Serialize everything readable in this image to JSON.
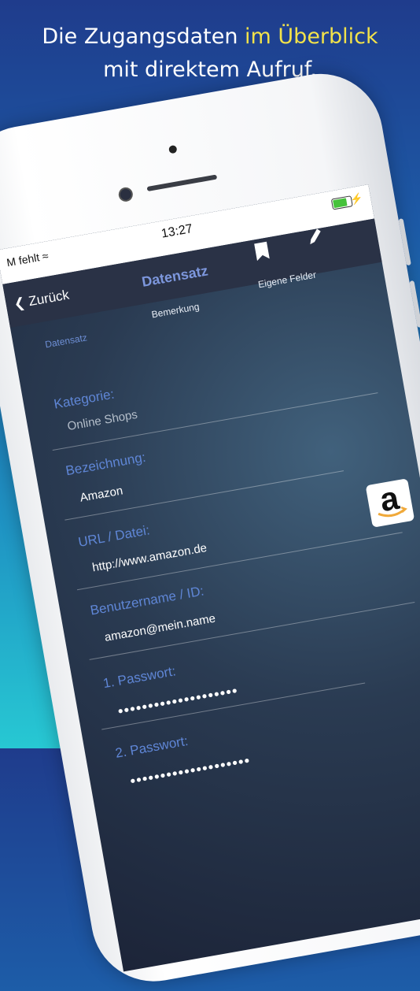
{
  "headline": {
    "line1_prefix": "Die Zugangsdaten ",
    "line1_highlight": "im Überblick",
    "line2": "mit direktem Aufruf."
  },
  "status": {
    "carrier": "M fehlt",
    "time": "13:27"
  },
  "nav": {
    "back_label": "Zurück",
    "title": "Datensatz"
  },
  "tabs": [
    {
      "label": "Datensatz",
      "active": true
    },
    {
      "label": "Bemerkung",
      "active": false
    },
    {
      "label": "Eigene Felder",
      "active": false
    }
  ],
  "fields": {
    "category_label": "Kategorie:",
    "category_value": "Online Shops",
    "name_label": "Bezeichnung:",
    "name_value": "Amazon",
    "url_label": "URL / Datei:",
    "url_value": "http://www.amazon.de",
    "user_label": "Benutzername / ID:",
    "user_value": "amazon@mein.name",
    "pw1_label": "1. Passwort:",
    "pw1_value": "●●●●●●●●●●●●●●●●●●●●",
    "pw2_label": "2. Passwort:",
    "pw2_value": "●●●●●●●●●●●●●●●●●●●●"
  },
  "logo": {
    "letter": "a"
  },
  "colors": {
    "accent": "#5f86d6",
    "highlight": "#f2e24a",
    "amazon_orange": "#f0a93a"
  }
}
